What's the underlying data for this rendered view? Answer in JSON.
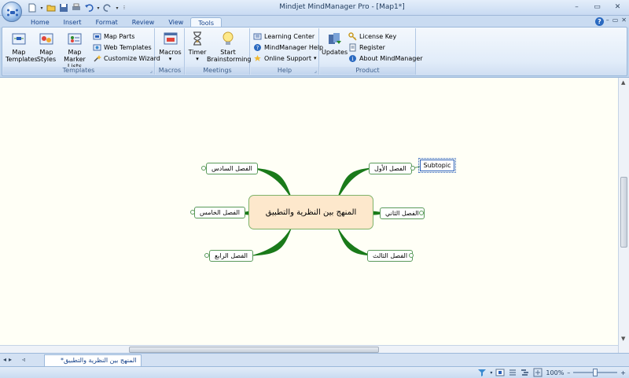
{
  "window": {
    "title": "Mindjet MindManager Pro - [Map1*]",
    "controls": [
      "–",
      "▭",
      "✕"
    ]
  },
  "tabs": [
    "Home",
    "Insert",
    "Format",
    "Review",
    "View",
    "Tools"
  ],
  "active_tab": "Tools",
  "tab_controls": [
    "–",
    "▭",
    "✕"
  ],
  "ribbon": {
    "templates": {
      "label": "Templates",
      "map_templates": "Map\nTemplates",
      "map_styles": "Map\nStyles",
      "map_marker_lists": "Map Marker\nLists",
      "map_parts": "Map Parts",
      "web_templates": "Web Templates",
      "customize_wizard": "Customize Wizard"
    },
    "macros": {
      "label": "Macros",
      "macros_btn": "Macros",
      "arrow": "▾"
    },
    "meetings": {
      "label": "Meetings",
      "timer": "Timer",
      "arrow": "▾",
      "start_brainstorming": "Start\nBrainstorming"
    },
    "help": {
      "label": "Help",
      "learning_center": "Learning Center",
      "mindmanager_help": "MindManager Help",
      "online_support": "Online Support",
      "arrow": "▾"
    },
    "product": {
      "label": "Product",
      "updates": "Updates",
      "license_key": "License Key",
      "register": "Register",
      "about": "About MindManager"
    }
  },
  "map": {
    "central": "المنهج بين النظرية والتطبيق",
    "topics": {
      "ch1": "الفصل الأول",
      "ch2": "الفصل الثاني",
      "ch3": "الفصل الثالث",
      "ch4": "الفصل الرابع",
      "ch5": "الفصل الخامس",
      "ch6": "الفصل السادس"
    },
    "subtopic": "Subtopic"
  },
  "document_tab": "المنهج بين النظرية والتطبيق*",
  "doc_nav": [
    "◂",
    "▸",
    "◃"
  ],
  "status": {
    "zoom": "100%",
    "minus": "–",
    "plus": "+"
  },
  "colors": {
    "branch": "#1a7a1a",
    "central_fill": "#fde8cc",
    "canvas": "#fffff6"
  }
}
